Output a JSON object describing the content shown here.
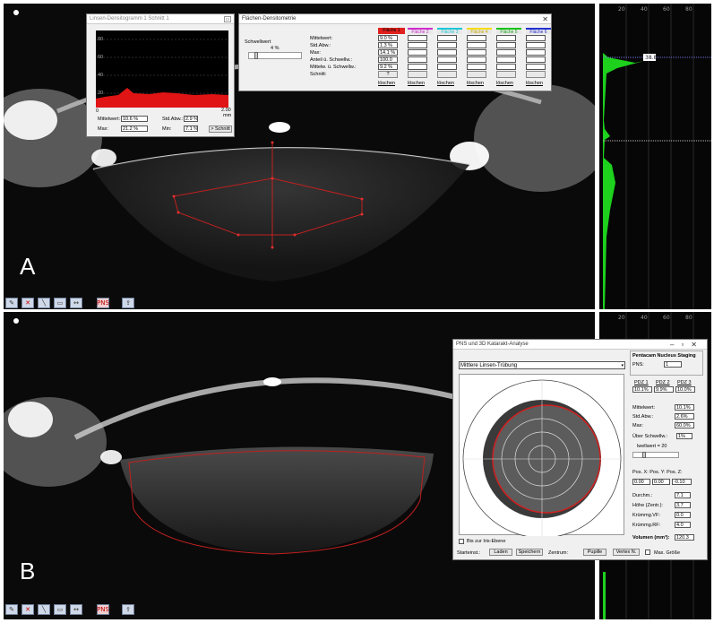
{
  "panels": {
    "a_letter": "A",
    "b_letter": "B"
  },
  "side_axis_ticks": [
    "20",
    "40",
    "60",
    "80"
  ],
  "side_readout": "38.8",
  "toolbar_icons": [
    "pen-icon",
    "delete-icon",
    "line-icon",
    "area-icon",
    "measure-icon",
    "pns-icon",
    "export-icon"
  ],
  "toolbar_pns_label": "PNS",
  "hist_window": {
    "title": "Linsen-Densitogramm 1 Schnitt 1",
    "y_ticks": [
      "80",
      "60",
      "40",
      "20",
      "0"
    ],
    "x_ticks": [
      "0",
      "2.00"
    ],
    "x_unit": "mm",
    "mittelwert_label": "Mittelwert:",
    "mittelwert": "10.6 %",
    "stdabw_label": "Std.Abw.:",
    "stdabw": "2.9 %",
    "max_label": "Max:",
    "max": "21.2 %",
    "min_label": "Min:",
    "min": "7.1 %",
    "schnitt_button": "> Schnitt"
  },
  "dens_window": {
    "title": "Flächen-Densitometrie",
    "schwellwert_label": "Schwellwert",
    "schwellwert_value": "4 %",
    "row_labels": [
      "Mittelwert:",
      "Std.Abw.:",
      "Max:",
      "Anteil ü. Schwellw.:",
      "Mittelw. ü. Schwellw.:",
      "Schnitt:"
    ],
    "area_headers": [
      "Fläche 1",
      "Fläche 2",
      "Fläche 3",
      "Fläche 4",
      "Fläche 5",
      "Fläche 6"
    ],
    "area_colors": [
      "#e0201c",
      "#d02ccf",
      "#1ec6d6",
      "#f5dc16",
      "#17c417",
      "#2430d0"
    ],
    "area1_values": [
      "9.0 %",
      "1.3 %",
      "14.1 %",
      "100.0",
      "9.2 %"
    ],
    "schnitt_value": "?",
    "loeschen": "löschen"
  },
  "pns_window": {
    "title": "PNS und 3D Katarakt-Analyse",
    "dropdown_value": "Mittlere Linsen-Trübung",
    "iris_checkbox": "Bis zur Iris-Ebene",
    "staging_title": "Pentacam Nucleus Staging",
    "pns_label": "PNS:",
    "pns_value": "1",
    "pdz_labels": [
      "PDZ 1",
      "PDZ 2",
      "PDZ 3"
    ],
    "pdz_values": [
      "10.1%",
      "9.9%",
      "10.0%"
    ],
    "mittelwert_label": "Mittelwert:",
    "mittelwert": "10.1%",
    "stdabw_label": "Std.Abw.:",
    "stdabw": "2.6%",
    "max_label": "Max:",
    "max": "60.0%",
    "ueber_label": "Über Schwellw.:",
    "ueber": "1%",
    "schwellwert_label": "lwellwert = 20",
    "pos_labels": "Pos. X: Pos. Y: Pos. Z:",
    "pos_x": "0.00",
    "pos_y": "0.00",
    "pos_z": "-0.10",
    "durchm_label": "Durchm.:",
    "durchm": "7.1",
    "hoehe_label": "Höhe (Zentr.):",
    "hoehe": "3.7",
    "kruemm_vf_label": "Krümmg.VF:",
    "kruemm_vf": "0.0",
    "kruemm_rf_label": "Krümmg.RF:",
    "kruemm_rf": "4.0",
    "volumen_label": "Volumen (mm³):",
    "volumen": "120.3",
    "startinst_label": "Starteinst.:",
    "laden_button": "Laden",
    "speichern_button": "Speichern",
    "zentrum_label": "Zentrum:",
    "pupille_button": "Pupille",
    "vertex_button": "Vertex N.",
    "max_groesse_checkbox": "Max. Größe"
  }
}
